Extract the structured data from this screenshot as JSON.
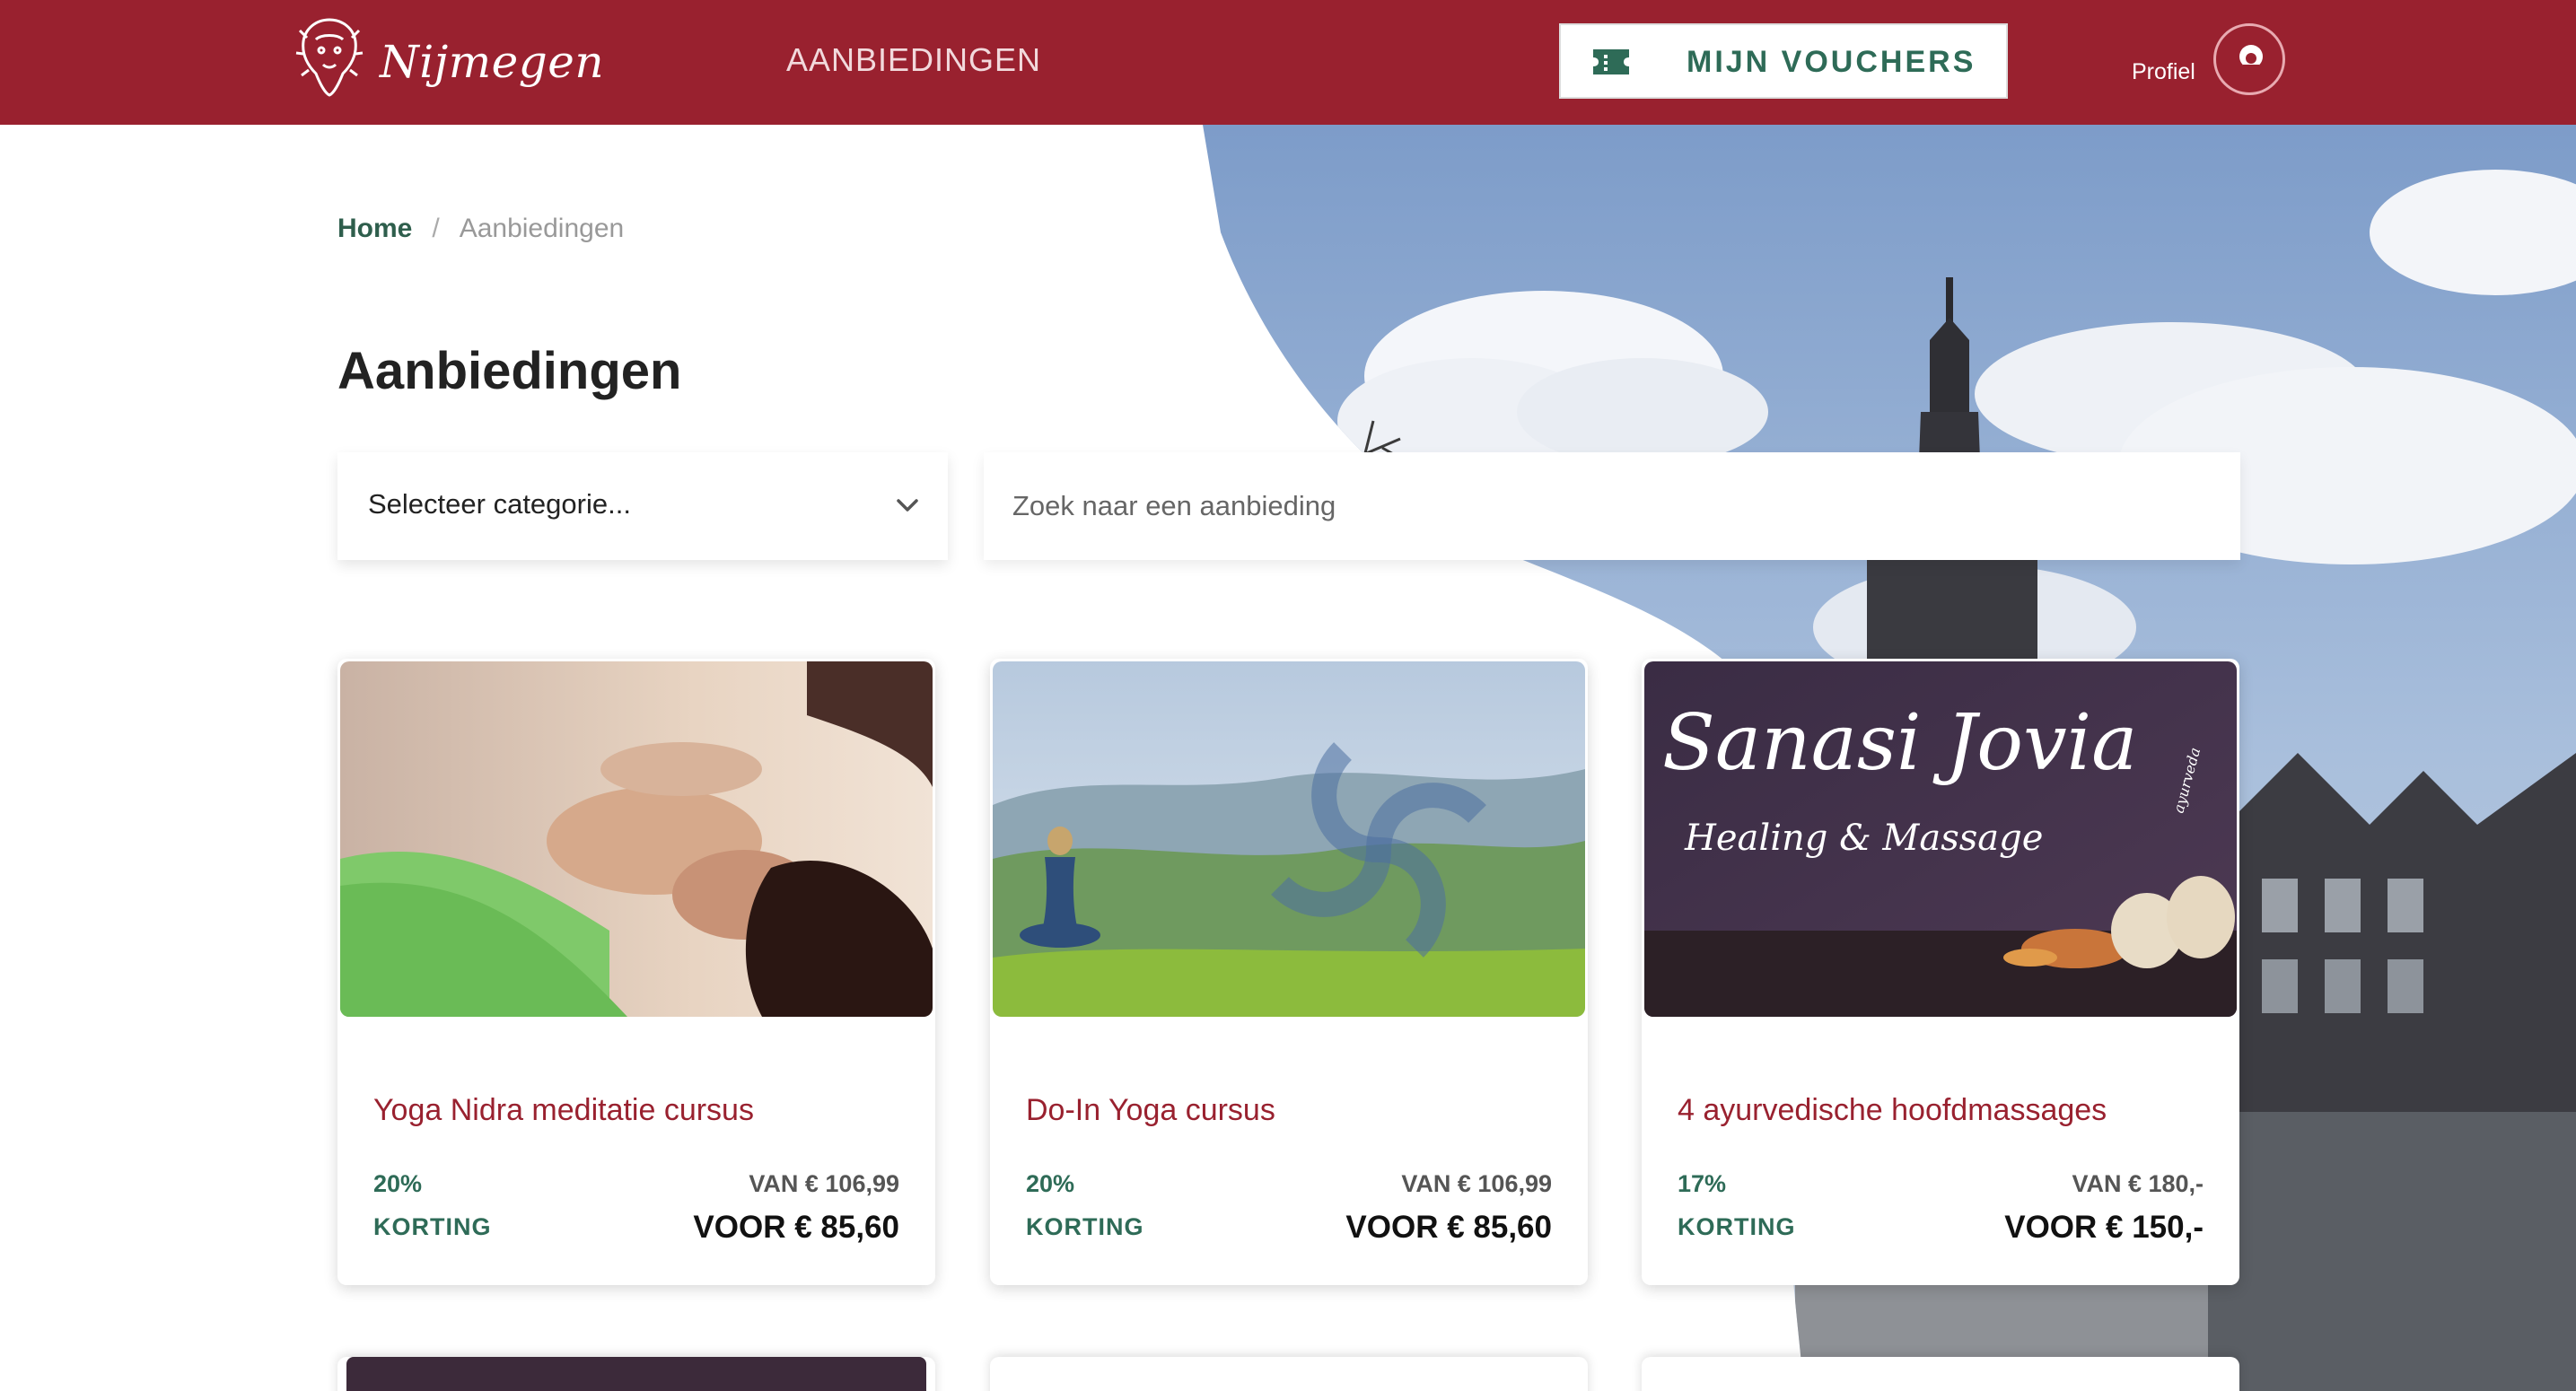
{
  "header": {
    "logo_text": "Nijmegen",
    "nav_label": "AANBIEDINGEN",
    "voucher_label": "MIJN VOUCHERS",
    "profile_label": "Profiel"
  },
  "breadcrumb": {
    "home": "Home",
    "separator": "/",
    "current": "Aanbiedingen"
  },
  "page_title": "Aanbiedingen",
  "filters": {
    "category_value": "Selecteer categorie...",
    "search_placeholder": "Zoek naar een aanbieding"
  },
  "cards": [
    {
      "title": "Yoga Nidra meditatie cursus",
      "discount_pct": "20%",
      "discount_label": "KORTING",
      "price_was": "VAN € 106,99",
      "price_now": "VOOR € 85,60"
    },
    {
      "title": "Do-In Yoga cursus",
      "discount_pct": "20%",
      "discount_label": "KORTING",
      "price_was": "VAN € 106,99",
      "price_now": "VOOR € 85,60"
    },
    {
      "title": "4 ayurvedische hoofdmassages",
      "discount_pct": "17%",
      "discount_label": "KORTING",
      "price_was": "VAN € 180,-",
      "price_now": "VOOR € 150,-",
      "image_text_main": "Sanasi Jovia",
      "image_text_sub": "Healing & Massage",
      "image_text_tag": "ayurveda"
    }
  ],
  "colors": {
    "brand_red": "#99212f",
    "accent_green": "#2e6b57",
    "breadcrumb_green": "#2e5e4c"
  },
  "icons": {
    "logo": "lion-crest-icon",
    "voucher": "ticket-icon",
    "profile": "user-icon",
    "select": "chevron-down-icon"
  }
}
